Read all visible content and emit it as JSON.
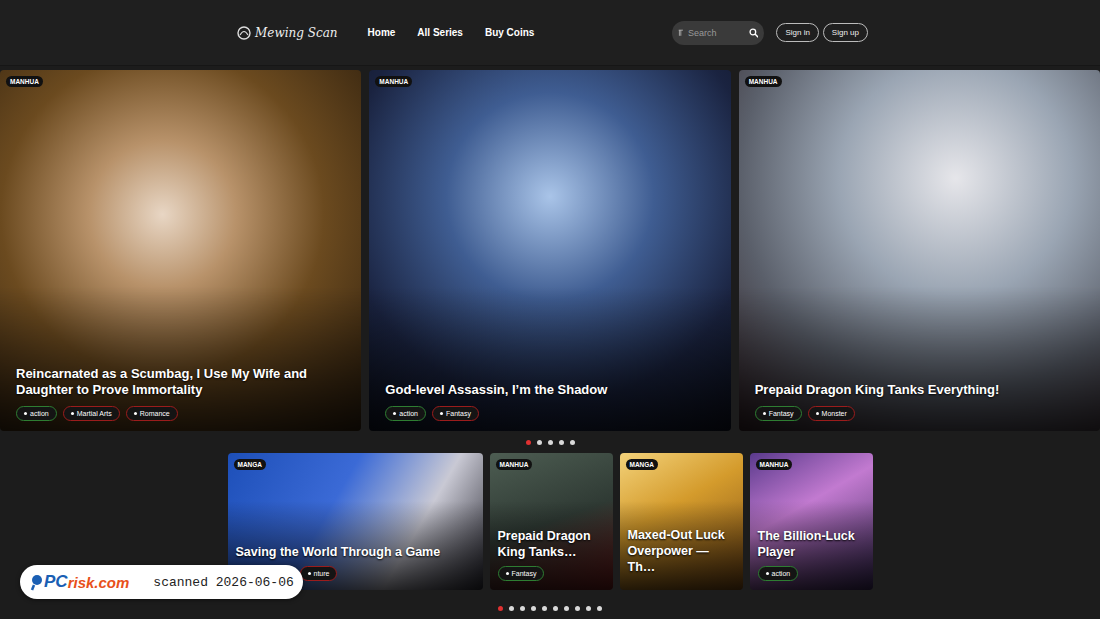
{
  "header": {
    "logo": "Mewing Scan",
    "nav": [
      {
        "label": "Home"
      },
      {
        "label": "All Series"
      },
      {
        "label": "Buy Coins"
      }
    ],
    "search": {
      "placeholder": "Search"
    },
    "buttons": [
      "Sign in",
      "Sign up"
    ]
  },
  "hero": {
    "cards": [
      {
        "type": "MANHUA",
        "title": "Reincarnated as a Scumbag, I Use My Wife and Daughter to Prove Immortality",
        "tags": [
          {
            "label": "action",
            "color": "#2e7d32"
          },
          {
            "label": "Martial Arts",
            "color": "#9b1c1c"
          },
          {
            "label": "Romance",
            "color": "#9b1c1c"
          }
        ]
      },
      {
        "type": "MANHUA",
        "title": "God-level Assassin, I’m the Shadow",
        "tags": [
          {
            "label": "action",
            "color": "#2e7d32"
          },
          {
            "label": "Fantasy",
            "color": "#9b1c1c"
          }
        ]
      },
      {
        "type": "MANHUA",
        "title": "Prepaid Dragon King Tanks Everything!",
        "tags": [
          {
            "label": "Fantasy",
            "color": "#2e7d32"
          },
          {
            "label": "Monster",
            "color": "#9b1c1c"
          }
        ]
      }
    ],
    "dots": [
      {
        "selected": true
      },
      {
        "selected": false
      },
      {
        "selected": false
      },
      {
        "selected": false
      },
      {
        "selected": false
      }
    ]
  },
  "featured": {
    "cards": [
      {
        "type": "MANGA",
        "title": "Saving the World Through a Game",
        "tags": [
          {
            "label": "nture",
            "color": "#9b1c1c"
          }
        ]
      },
      {
        "type": "MANHUA",
        "title": "Prepaid Dragon King Tanks…",
        "tags": [
          {
            "label": "Fantasy",
            "color": "#2e7d32"
          }
        ]
      },
      {
        "type": "MANGA",
        "title": "Maxed-Out Luck Overpower — Th…",
        "tags": []
      },
      {
        "type": "MANHUA",
        "title": "The Billion-Luck Player",
        "tags": [
          {
            "label": "action",
            "color": "#2e7d32"
          }
        ]
      }
    ],
    "dots": [
      {
        "selected": true
      },
      {
        "selected": false
      },
      {
        "selected": false
      },
      {
        "selected": false
      },
      {
        "selected": false
      },
      {
        "selected": false
      },
      {
        "selected": false
      },
      {
        "selected": false
      },
      {
        "selected": false
      },
      {
        "selected": false
      }
    ]
  },
  "watermark": {
    "brand_pc": "PC",
    "brand_rest": "risk.com",
    "text": "scanned 2026-06-06"
  }
}
